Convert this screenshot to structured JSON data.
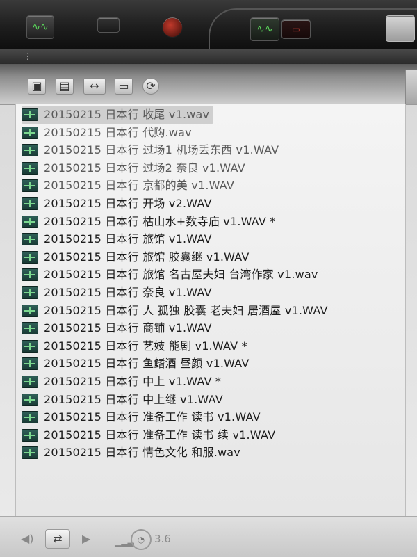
{
  "toolbar": {
    "icons": [
      "wave-icon",
      "folder-icon",
      "arrows-icon",
      "monitor-icon",
      "refresh-icon"
    ]
  },
  "files": [
    "20150215 日本行 收尾 v1.wav",
    "20150215 日本行 代购.wav",
    "20150215 日本行 过场1 机场丢东西 v1.WAV",
    "20150215 日本行 过场2 奈良 v1.WAV",
    "20150215 日本行 京都的美 v1.WAV",
    "20150215 日本行 开场 v2.WAV",
    "20150215 日本行 枯山水+数寺庙 v1.WAV *",
    "20150215 日本行 旅馆 v1.WAV",
    "20150215 日本行 旅馆 胶囊继 v1.WAV",
    "20150215 日本行 旅馆 名古屋夫妇 台湾作家 v1.wav",
    "20150215 日本行 奈良 v1.WAV",
    "20150215 日本行 人 孤独 胶囊 老夫妇 居酒屋 v1.WAV",
    "20150215 日本行 商铺 v1.WAV",
    "20150215 日本行 艺妓 能剧 v1.WAV *",
    "20150215 日本行 鱼鳍酒 昼颜 v1.WAV",
    "20150215 日本行 中上 v1.WAV *",
    "20150215 日本行 中上继 v1.WAV",
    "20150215 日本行 准备工作 读书 v1.WAV",
    "20150215 日本行 准备工作 读书 续 v1.WAV",
    "20150215 日本行 情色文化 和服.wav"
  ],
  "status": {
    "zoom": "3.6"
  },
  "colors": {
    "accent_green": "#5ad65a",
    "accent_red": "#d9443a"
  }
}
